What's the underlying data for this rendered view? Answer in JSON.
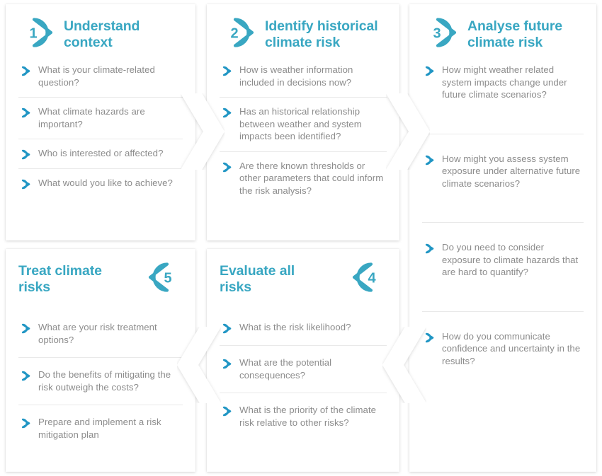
{
  "meta": {
    "accent_color": "#39a7c2",
    "title_color": "#39a7c2",
    "text_color": "#8c8c8c",
    "panel_background": "#ffffff",
    "page_background": "#ffffff",
    "divider_color": "#e9e9e9"
  },
  "panels": [
    {
      "number": "1",
      "title": "Understand\ncontext",
      "badge_direction": "right",
      "title_side": "right",
      "items": [
        "What is your climate-related question?",
        "What climate hazards are important?",
        "Who is interested or affected?",
        "What would you like to achieve?"
      ]
    },
    {
      "number": "2",
      "title": "Identify historical\nclimate risk",
      "badge_direction": "right",
      "title_side": "right",
      "items": [
        "How is weather information included in decisions now?",
        "Has an historical relationship between weather and system impacts been identified?",
        "Are there known thresholds or other parameters that could inform the risk analysis?"
      ]
    },
    {
      "number": "3",
      "title": "Analyse future\nclimate risk",
      "badge_direction": "right",
      "title_side": "right",
      "items": [
        "How might weather related system impacts change under future climate scenarios?",
        "How might you assess system exposure under alternative future climate scenarios?",
        "Do you need to consider exposure to climate hazards that are hard to quantify?",
        "How do you communicate confidence and uncertainty in the results?"
      ]
    },
    {
      "number": "5",
      "title": "Treat climate\nrisks",
      "badge_direction": "left",
      "title_side": "left",
      "items": [
        "What are your risk treatment options?",
        "Do the benefits of mitigating the risk outweigh the costs?",
        "Prepare and implement a risk mitigation plan"
      ]
    },
    {
      "number": "4",
      "title": "Evaluate all\nrisks",
      "badge_direction": "left",
      "title_side": "left",
      "items": [
        "What is the risk likelihood?",
        "What are the potential consequences?",
        "What is the priority of the climate risk relative to other risks?"
      ]
    }
  ],
  "connectors": [
    {
      "name": "connector-1-to-2",
      "direction": "right"
    },
    {
      "name": "connector-2-to-3",
      "direction": "right"
    },
    {
      "name": "connector-3-to-4",
      "direction": "left"
    },
    {
      "name": "connector-4-to-5",
      "direction": "left"
    }
  ]
}
